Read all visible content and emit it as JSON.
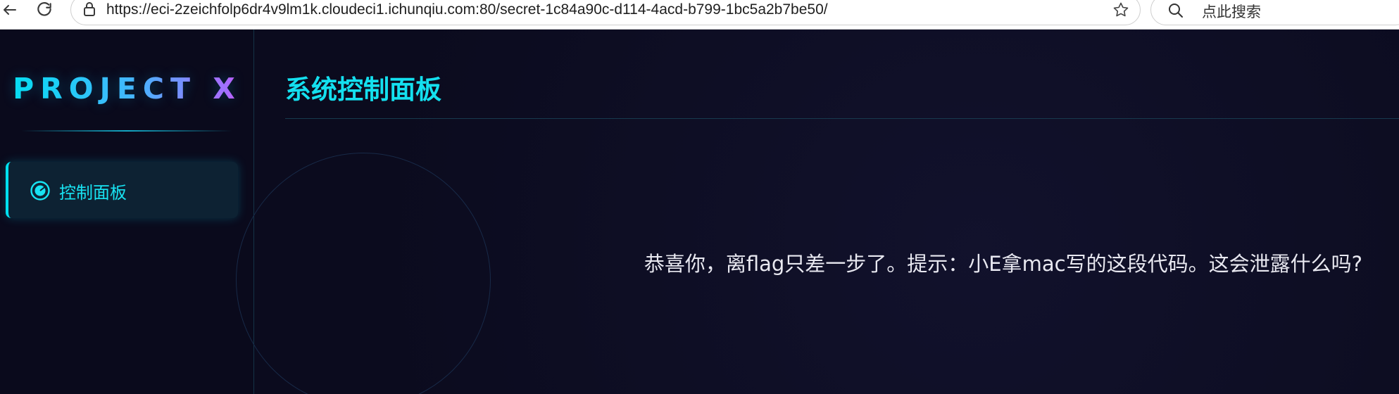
{
  "browser": {
    "url": "https://eci-2zeichfolp6dr4v9lm1k.cloudeci1.ichunqiu.com:80/secret-1c84a90c-d114-4acd-b799-1bc5a2b7be50/",
    "search_placeholder": "点此搜索",
    "icons": [
      "back-arrow-icon",
      "reload-icon",
      "lock-icon",
      "star-icon",
      "search-icon"
    ]
  },
  "sidebar": {
    "logo": "PROJECT X",
    "items": [
      {
        "label": "控制面板",
        "icon": "radar-icon",
        "active": true
      }
    ]
  },
  "main": {
    "title": "系统控制面板",
    "message": "恭喜你，离flag只差一步了。提示：小E拿mac写的这段代码。这会泄露什么吗?"
  },
  "colors": {
    "background": "#0b0b1e",
    "accent": "#14e0ef",
    "logo_gradient_end": "#d94bff",
    "text": "#e8e8f0"
  }
}
